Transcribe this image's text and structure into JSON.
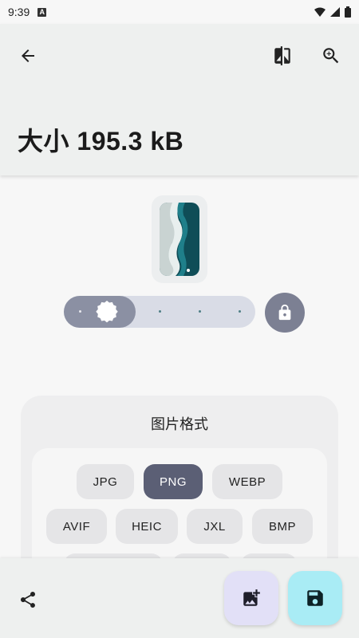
{
  "status_bar": {
    "time": "9:39",
    "badge": "A",
    "icons": [
      "wifi-icon",
      "signal-icon",
      "battery-icon"
    ]
  },
  "header": {
    "back_icon": "arrow-back-icon",
    "compare_icon": "compare-icon",
    "zoom_icon": "zoom-in-icon",
    "title": "大小 195.3 kB"
  },
  "preview": {
    "image_desc": "beach-thumbnail"
  },
  "quality_slider": {
    "level": 0.0,
    "steps": 5,
    "lock_icon": "lock-icon"
  },
  "format_section": {
    "title": "图片格式",
    "options": [
      {
        "label": "JPG",
        "selected": false
      },
      {
        "label": "PNG",
        "selected": true
      },
      {
        "label": "WEBP",
        "selected": false
      },
      {
        "label": "AVIF",
        "selected": false
      },
      {
        "label": "HEIC",
        "selected": false
      },
      {
        "label": "JXL",
        "selected": false
      },
      {
        "label": "BMP",
        "selected": false
      }
    ]
  },
  "bottom_bar": {
    "share_icon": "share-icon",
    "add_image_icon": "add-photo-icon",
    "save_icon": "save-icon"
  },
  "colors": {
    "accent": "#5b5f75",
    "save_fab": "#a9ecf5",
    "add_fab": "#e2e0f7",
    "slider_track": "#d9dce6",
    "slider_fill": "#8b90a3"
  }
}
